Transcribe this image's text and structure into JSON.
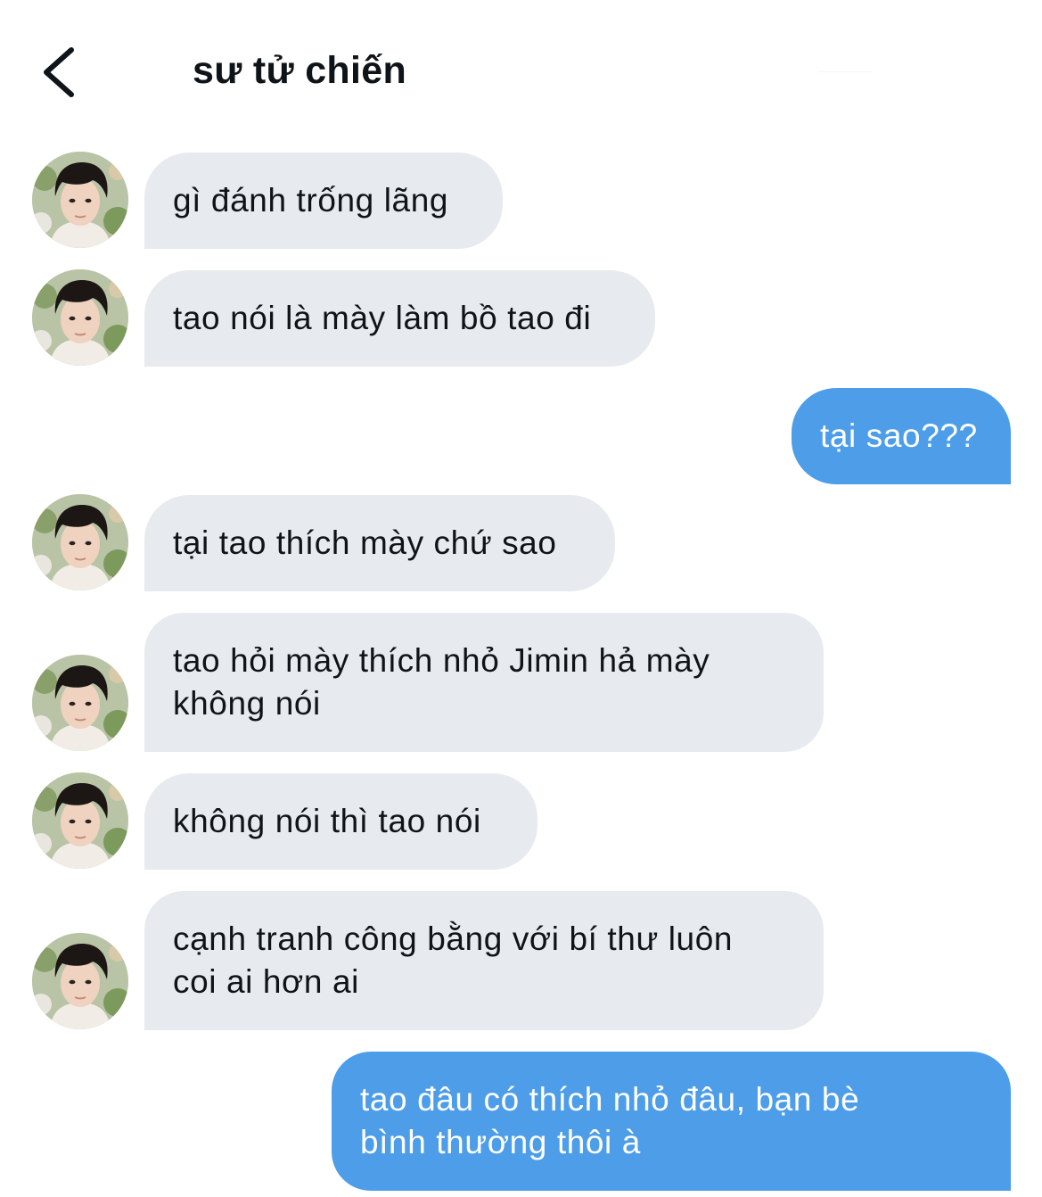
{
  "header": {
    "title": "sư tử chiến",
    "back_icon": "chevron-left-icon"
  },
  "colors": {
    "incoming_bubble": "#e7ebef",
    "outgoing_bubble": "#4d9de9",
    "incoming_text": "#0f1419",
    "outgoing_text": "#ffffff"
  },
  "messages": [
    {
      "direction": "incoming",
      "text": "gì đánh trống lãng"
    },
    {
      "direction": "incoming",
      "text": "tao nói là mày làm bồ tao đi"
    },
    {
      "direction": "outgoing",
      "text": "tại sao???"
    },
    {
      "direction": "incoming",
      "text": "tại tao thích mày chứ sao"
    },
    {
      "direction": "incoming",
      "lines": [
        "tao hỏi mày thích nhỏ Jimin hả mày",
        "không nói"
      ]
    },
    {
      "direction": "incoming",
      "text": "không nói thì tao nói"
    },
    {
      "direction": "incoming",
      "lines": [
        "cạnh tranh công bằng với bí thư luôn",
        "coi ai hơn ai"
      ]
    },
    {
      "direction": "outgoing",
      "lines": [
        "tao đâu có thích nhỏ đâu, bạn bè",
        "bình thường thôi à"
      ]
    }
  ]
}
